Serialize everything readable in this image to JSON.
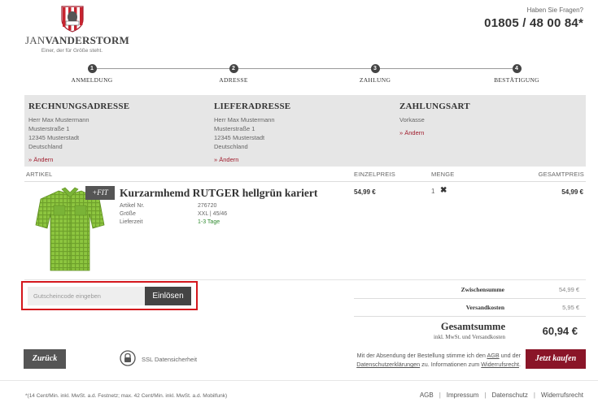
{
  "header": {
    "logo_prefix": "JAN",
    "logo_name": "VANDERSTORM",
    "logo_tagline": "Einer, der für Größe steht.",
    "hotline_label": "Haben Sie Fragen?",
    "hotline_number": "01805 / 48 00 84*"
  },
  "steps": [
    {
      "num": "1",
      "label": "ANMELDUNG"
    },
    {
      "num": "2",
      "label": "ADRESSE"
    },
    {
      "num": "3",
      "label": "ZAHLUNG"
    },
    {
      "num": "4",
      "label": "BESTÄTIGUNG"
    }
  ],
  "billing": {
    "title": "RECHNUNGSADRESSE",
    "lines": [
      "Herr Max Mustermann",
      "Musterstraße 1",
      "12345 Musterstadt",
      "Deutschland"
    ],
    "change": "» Ändern"
  },
  "shipping": {
    "title": "LIEFERADRESSE",
    "lines": [
      "Herr Max Mustermann",
      "Musterstraße 1",
      "12345 Musterstadt",
      "Deutschland"
    ],
    "change": "» Ändern"
  },
  "payment": {
    "title": "ZAHLUNGSART",
    "method": "Vorkasse",
    "change": "» Ändern"
  },
  "table": {
    "col_article": "ARTIKEL",
    "col_unit_price": "EINZELPREIS",
    "col_qty": "MENGE",
    "col_total": "GESAMTPREIS"
  },
  "product": {
    "badge": "+FIT",
    "title": "Kurzarmhemd RUTGER hellgrün kariert",
    "meta": [
      {
        "key": "Artikel Nr.",
        "value": "276720"
      },
      {
        "key": "Größe",
        "value": "XXL | 45/46"
      },
      {
        "key": "Lieferzeit",
        "value": "1-3 Tage"
      }
    ],
    "unit_price": "54,99 €",
    "qty": "1",
    "remove_icon": "✖",
    "total": "54,99 €"
  },
  "voucher": {
    "placeholder": "Gutscheincode eingeben",
    "button": "Einlösen"
  },
  "totals": {
    "subtotal_label": "Zwischensumme",
    "subtotal": "54,99 €",
    "shipping_label": "Versandkosten",
    "shipping": "5,95 €",
    "grand_label": "Gesamtsumme",
    "grand_sub": "inkl. MwSt. und Versandkosten",
    "grand": "60,94 €"
  },
  "actions": {
    "back": "Zurück",
    "ssl": "SSL Datensicherheit",
    "legal_1": "Mit der Absendung der Bestellung stimme ich den ",
    "legal_agb": "AGB",
    "legal_2": " und der",
    "legal_privacy": "Datenschutzerklärungen",
    "legal_3": " zu. Informationen zum ",
    "legal_withdrawal": "Widerrufsrecht",
    "legal_4": ".",
    "buy": "Jetzt kaufen"
  },
  "footer": {
    "note": "*(14 Cent/Min. inkl. MwSt. a.d. Festnetz; max. 42 Cent/Min. inkl. MwSt. a.d. Mobilfunk)",
    "links": [
      "AGB",
      "Impressum",
      "Datenschutz",
      "Widerrufsrecht"
    ]
  },
  "colors": {
    "accent": "#8a1528",
    "link": "#a01c2c",
    "highlight_border": "#d4161c",
    "shirt": "#8dc63f"
  }
}
